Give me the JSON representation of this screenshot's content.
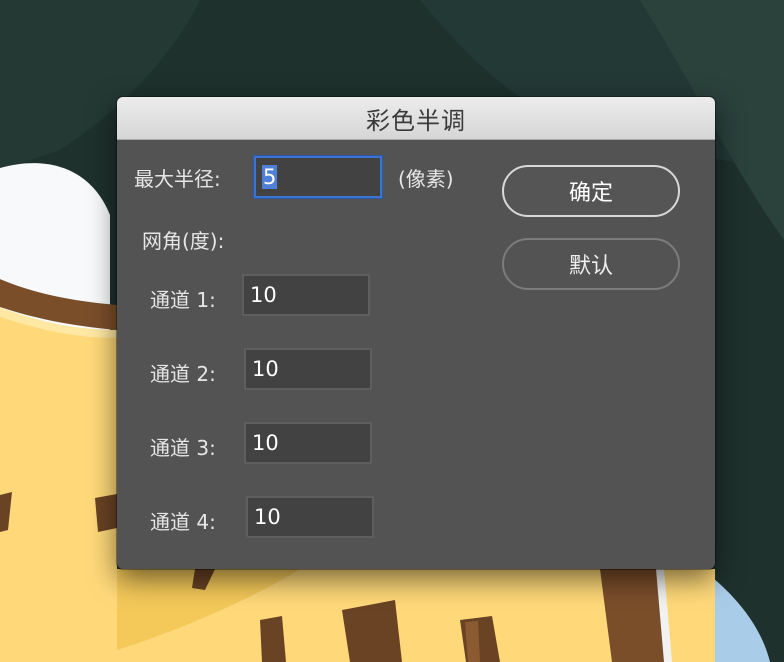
{
  "dialog": {
    "title": "彩色半调",
    "radius_label": "最大半径:",
    "radius_value": "5",
    "unit_label": "(像素)",
    "angles_label": "网角(度):",
    "channels": [
      {
        "label": "通道 1:",
        "value": "10"
      },
      {
        "label": "通道 2:",
        "value": "10"
      },
      {
        "label": "通道 3:",
        "value": "10"
      },
      {
        "label": "通道 4:",
        "value": "10"
      }
    ],
    "ok_label": "确定",
    "default_label": "默认"
  },
  "colors": {
    "background": "#1e312d",
    "dialog_body": "#535353",
    "focus_ring": "#3a73d0"
  }
}
